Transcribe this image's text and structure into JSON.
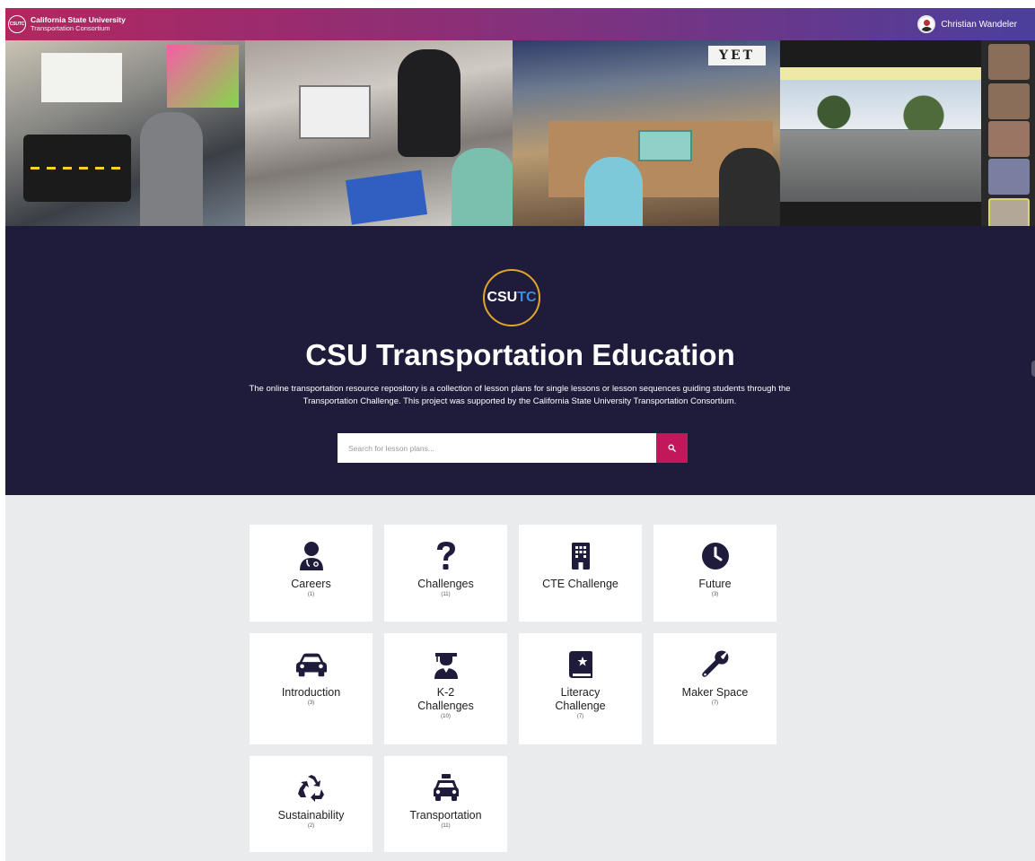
{
  "header": {
    "brand_line1": "California State University",
    "brand_line2": "Transportation Consortium",
    "brand_logo_text": "CSUTC",
    "user_name": "Christian Wandeler"
  },
  "banner": {
    "sign_text": "YET"
  },
  "hero": {
    "logo_csu": "CSU",
    "logo_tc": "TC",
    "title": "CSU Transportation Education",
    "description": "The online transportation resource repository is a collection of lesson plans for single lessons or lesson sequences guiding students through the Transportation Challenge. This project was supported by the California State University Transportation Consortium.",
    "search_placeholder": "Search for lesson plans...",
    "search_icon": "search-icon"
  },
  "categories": [
    {
      "label": "Careers",
      "count": "(1)",
      "icon": "user-doctor-icon"
    },
    {
      "label": "Challenges",
      "count": "(11)",
      "icon": "question-mark-icon"
    },
    {
      "label": "CTE Challenge",
      "count": "",
      "icon": "building-icon"
    },
    {
      "label": "Future",
      "count": "(3)",
      "icon": "clock-icon"
    },
    {
      "label": "Introduction",
      "count": "(3)",
      "icon": "car-icon"
    },
    {
      "label": "K-2 Challenges",
      "count": "(10)",
      "icon": "graduate-icon"
    },
    {
      "label": "Literacy Challenge",
      "count": "(7)",
      "icon": "book-icon"
    },
    {
      "label": "Maker Space",
      "count": "(7)",
      "icon": "wrench-icon"
    },
    {
      "label": "Sustainability",
      "count": "(2)",
      "icon": "recycle-icon"
    },
    {
      "label": "Transportation",
      "count": "(11)",
      "icon": "taxi-icon"
    }
  ],
  "colors": {
    "topbar_start": "#b2275f",
    "topbar_end": "#4b3f9c",
    "hero_bg": "#1f1b3b",
    "search_button": "#c2185b",
    "logo_ring": "#e2a52a",
    "page_bg": "#eaebed",
    "icon": "#1f1b3b"
  }
}
